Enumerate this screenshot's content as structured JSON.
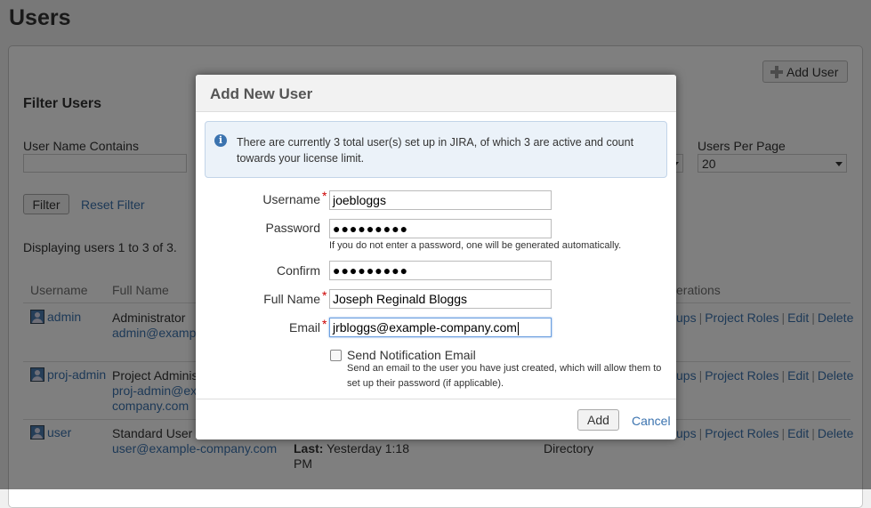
{
  "page": {
    "title": "Users",
    "add_user_label": "Add User"
  },
  "filter": {
    "heading": "Filter Users",
    "username_label": "User Name Contains",
    "per_page_label": "Users Per Page",
    "per_page_value": "20",
    "filter_button": "Filter",
    "reset_link": "Reset Filter"
  },
  "listing": {
    "display_text": "Displaying users 1 to 3 of 3.",
    "headers": {
      "username": "Username",
      "full_name": "Full Name",
      "operations": "erations"
    },
    "rows": [
      {
        "username": "admin",
        "full_name": "Administrator",
        "email_line1": "admin@example",
        "email_line2": ""
      },
      {
        "username": "proj-admin",
        "full_name": "Project Administ",
        "email_line1": "proj-admin@exa",
        "email_line2": "company.com"
      },
      {
        "username": "user",
        "full_name": "Standard User",
        "email_line1": "user@example-company.com",
        "email_line2": ""
      }
    ],
    "last_login": {
      "label": "Last:",
      "value": "Yesterday 1:18",
      "value2": "PM"
    },
    "directory": "Directory",
    "ops": {
      "groups_fragment": "ups",
      "project_roles": "Project Roles",
      "edit": "Edit",
      "delete": "Delete"
    }
  },
  "dialog": {
    "title": "Add New User",
    "info": "There are currently 3 total user(s) set up in JIRA, of which 3 are active and count towards your license limit.",
    "username": {
      "label": "Username",
      "value": "joebloggs"
    },
    "password": {
      "label": "Password",
      "masked": "●●●●●●●●●",
      "hint": "If you do not enter a password, one will be generated automatically."
    },
    "confirm": {
      "label": "Confirm",
      "masked": "●●●●●●●●●"
    },
    "full_name": {
      "label": "Full Name",
      "value": "Joseph Reginald Bloggs"
    },
    "email": {
      "label": "Email",
      "value": "jrbloggs@example-company.com"
    },
    "required_mark": "*",
    "notify": {
      "label": "Send Notification Email",
      "checked": false,
      "hint_line1": "Send an email to the user you have just created, which will allow them to",
      "hint_line2": "set up their password (if applicable)."
    },
    "add_button": "Add",
    "cancel_link": "Cancel"
  },
  "colors": {
    "link": "#3b73af",
    "required": "#cc0000",
    "info_bg": "#ebf2f9",
    "info_icon": "#3b73af"
  },
  "icons": {
    "add_user": "plus-icon",
    "info": "info-icon",
    "user_avatar": "avatar-icon",
    "select": "chevron-down-icon"
  }
}
